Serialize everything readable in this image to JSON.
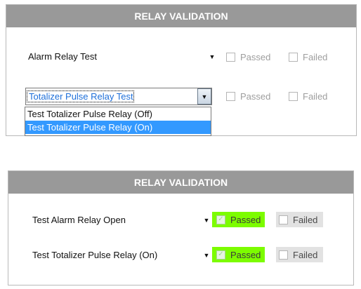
{
  "top_panel": {
    "title": "RELAY VALIDATION",
    "alarm_select": {
      "value": "Alarm Relay Test"
    },
    "alarm_passed_label": "Passed",
    "alarm_failed_label": "Failed",
    "totalizer_select": {
      "value": "Totalizer Pulse Relay Test",
      "options": [
        "Test Totalizer Pulse Relay (Off)",
        "Test Totalizer Pulse Relay (On)"
      ],
      "highlighted": "Test Totalizer Pulse Relay (On)"
    },
    "totalizer_passed_label": "Passed",
    "totalizer_failed_label": "Failed"
  },
  "bottom_panel": {
    "title": "RELAY VALIDATION",
    "alarm_select": {
      "value": "Test Alarm Relay Open"
    },
    "alarm_passed_label": "Passed",
    "alarm_passed_checked": true,
    "alarm_failed_label": "Failed",
    "totalizer_select": {
      "value": "Test Totalizer Pulse Relay (On)"
    },
    "totalizer_passed_label": "Passed",
    "totalizer_passed_checked": true,
    "totalizer_failed_label": "Failed"
  },
  "colors": {
    "header_bg": "#999999",
    "passed_highlight": "#7cfc00",
    "selection_blue": "#3399ff"
  }
}
